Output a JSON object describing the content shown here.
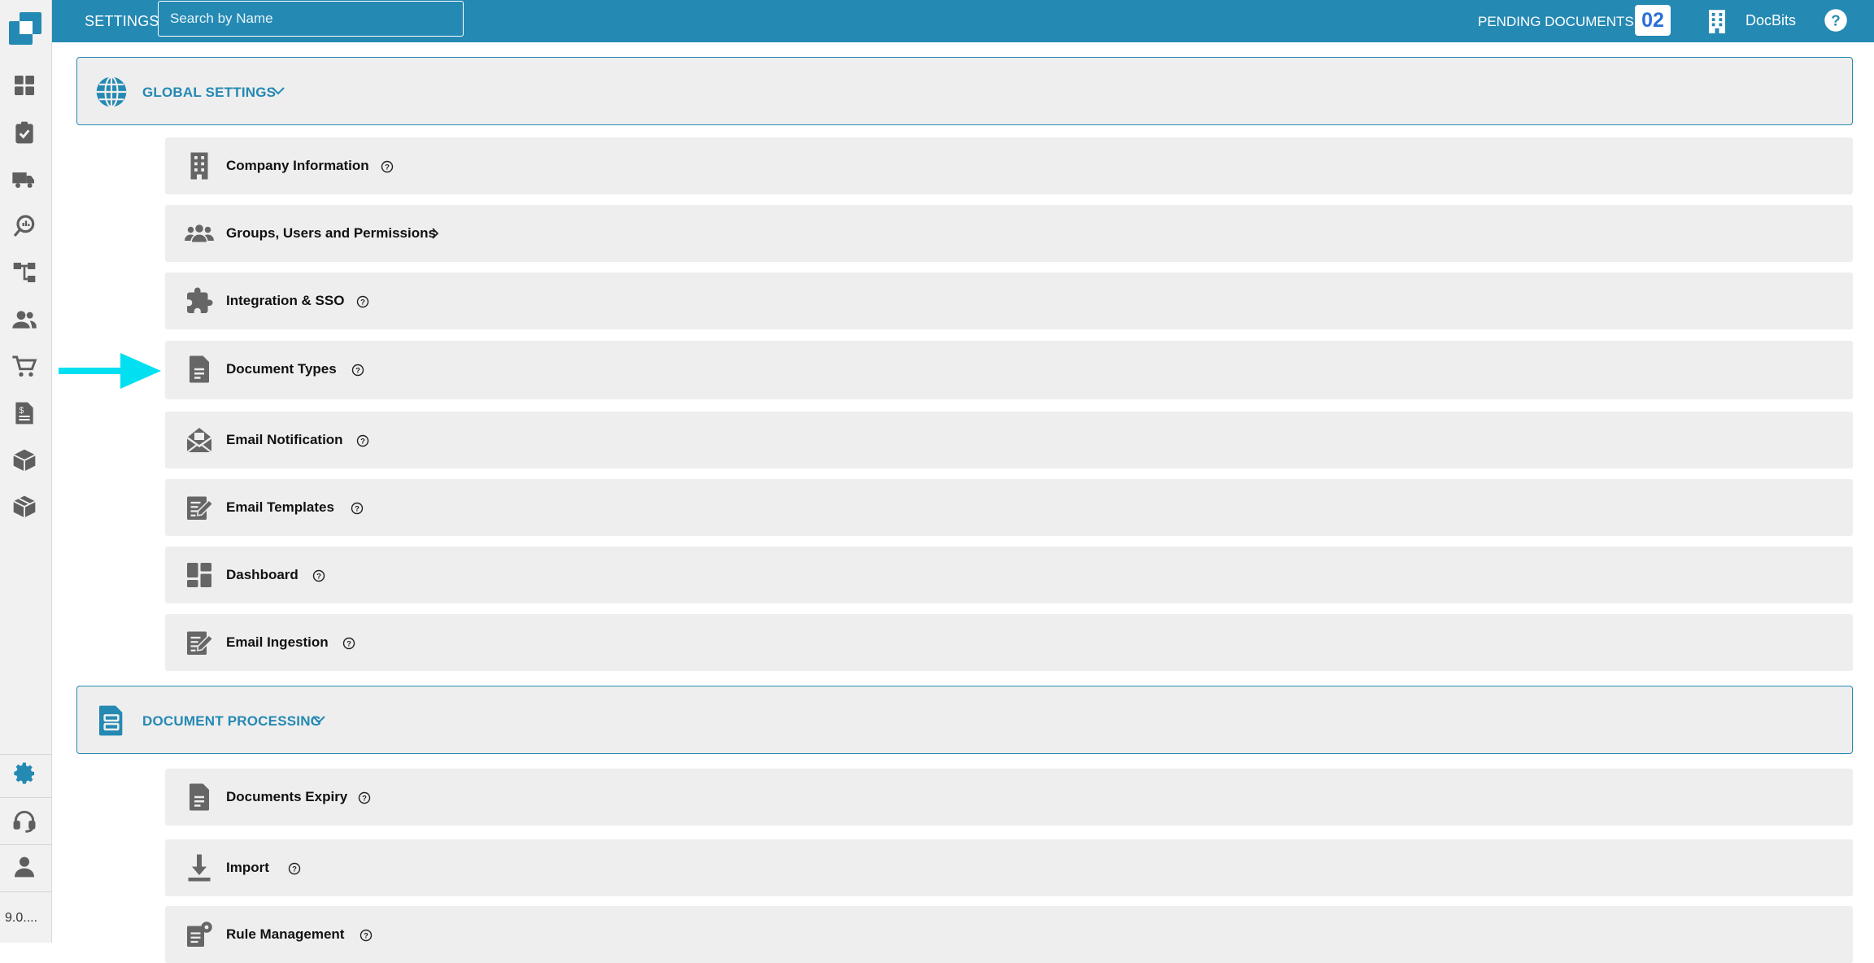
{
  "sidebar": {
    "version": "9.0...."
  },
  "topbar": {
    "title": "SETTINGS",
    "search_placeholder": "Search by Name",
    "pending_label": "PENDING DOCUMENTS:",
    "pending_count": "02",
    "org_name": "DocBits"
  },
  "sections": {
    "global": {
      "title": "GLOBAL SETTINGS",
      "items": [
        {
          "label": "Company Information",
          "icon": "building-icon"
        },
        {
          "label": "Groups, Users and Permissions",
          "icon": "users-group-icon"
        },
        {
          "label": "Integration & SSO",
          "icon": "puzzle-icon"
        },
        {
          "label": "Document Types",
          "icon": "document-icon"
        },
        {
          "label": "Email Notification",
          "icon": "mail-open-icon"
        },
        {
          "label": "Email Templates",
          "icon": "email-template-icon"
        },
        {
          "label": "Dashboard",
          "icon": "dashboard-icon"
        },
        {
          "label": "Email Ingestion",
          "icon": "email-template-icon"
        }
      ]
    },
    "processing": {
      "title": "DOCUMENT PROCESSING",
      "items": [
        {
          "label": "Documents Expiry",
          "icon": "document-icon"
        },
        {
          "label": "Import",
          "icon": "download-icon"
        },
        {
          "label": "Rule Management",
          "icon": "rule-icon"
        }
      ]
    }
  },
  "colors": {
    "accent": "#2489b3",
    "row_bg": "#eeeeee",
    "pointer_arrow": "#00e0f0",
    "icon_gray": "#666666"
  }
}
